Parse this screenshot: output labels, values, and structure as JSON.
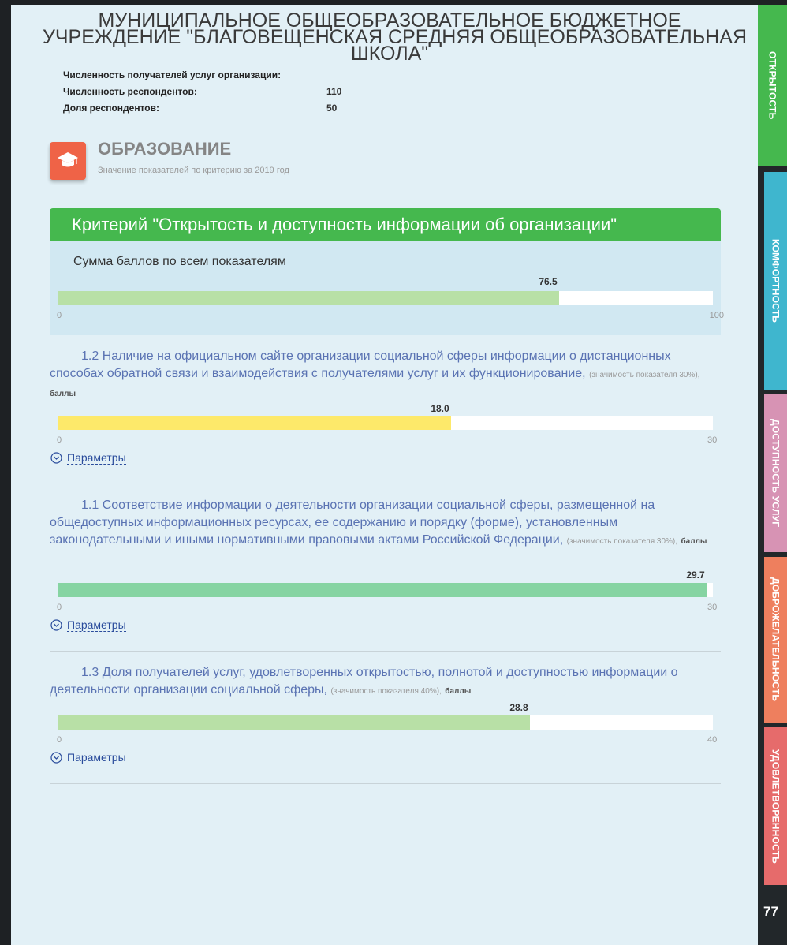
{
  "org": {
    "title_lines": [
      "МУНИЦИПАЛЬНОЕ ОБЩЕОБРАЗОВАТЕЛЬНОЕ БЮДЖЕТНОЕ",
      "УЧРЕЖДЕНИЕ \"БЛАГОВЕЩЕНСКАЯ СРЕДНЯЯ ОБЩЕОБРАЗОВАТЕЛЬНАЯ",
      "ШКОЛА\""
    ]
  },
  "stats": [
    {
      "label": "Численность получателей услуг организации:",
      "value": ""
    },
    {
      "label": "Численность респондентов:",
      "value": "110"
    },
    {
      "label": "Доля респондентов:",
      "value": "50"
    }
  ],
  "section": {
    "icon": "graduation-cap-icon",
    "title": "ОБРАЗОВАНИЕ",
    "subtitle": "Значение показателей по критерию за 2019 год"
  },
  "criterion": {
    "title": "Критерий \"Открытость и доступность информации об организации\"",
    "sum_label": "Сумма баллов по всем показателям",
    "sum_value": "76.5",
    "sum_fraction": 0.765,
    "min": "0",
    "max": "100",
    "fill_color": "#b8e0a6"
  },
  "indicators": [
    {
      "text": "1.2 Наличие на официальном сайте организации социальной сферы информации о дистанционных способах обратной связи и взаимодействия с получателями услуг и их функционирование,",
      "note": "(значимость показателя 30%),",
      "unit": "баллы",
      "value": "18.0",
      "fraction": 0.6,
      "min": "0",
      "max": "30",
      "color": "#fde96a",
      "params_label": "Параметры"
    },
    {
      "text": "1.1 Соответствие информации о деятельности организации социальной сферы, размещенной на общедоступных информационных ресурсах, ее содержанию и порядку (форме), установленным законодательными и иными нормативными правовыми актами Российской Федерации,",
      "note": "(значимость показателя 30%),",
      "unit": "баллы",
      "value": "29.7",
      "fraction": 0.99,
      "min": "0",
      "max": "30",
      "color": "#86d4a2",
      "params_label": "Параметры"
    },
    {
      "text": "1.3 Доля получателей услуг, удовлетворенных открытостью, полнотой и доступностью информации о деятельности организации социальной сферы,",
      "note": "(значимость показателя 40%),",
      "unit": "баллы",
      "value": "28.8",
      "fraction": 0.72,
      "min": "0",
      "max": "40",
      "color": "#b8e0a6",
      "params_label": "Параметры"
    }
  ],
  "side_tabs": [
    {
      "label": "ОТКРЫТОСТЬ",
      "color": "#45b84e"
    },
    {
      "label": "КОМФОРТНОСТЬ",
      "color": "#3fb6ce"
    },
    {
      "label": "ДОСТУПНОСТЬ УСЛУГ",
      "color": "#d793b4"
    },
    {
      "label": "ДОБРОЖЕЛАТЕЛЬНОСТЬ",
      "color": "#ee7f5e"
    },
    {
      "label": "УДОВЛЕТВОРЕННОСТЬ",
      "color": "#e66b6b"
    }
  ],
  "corner_number": "77"
}
